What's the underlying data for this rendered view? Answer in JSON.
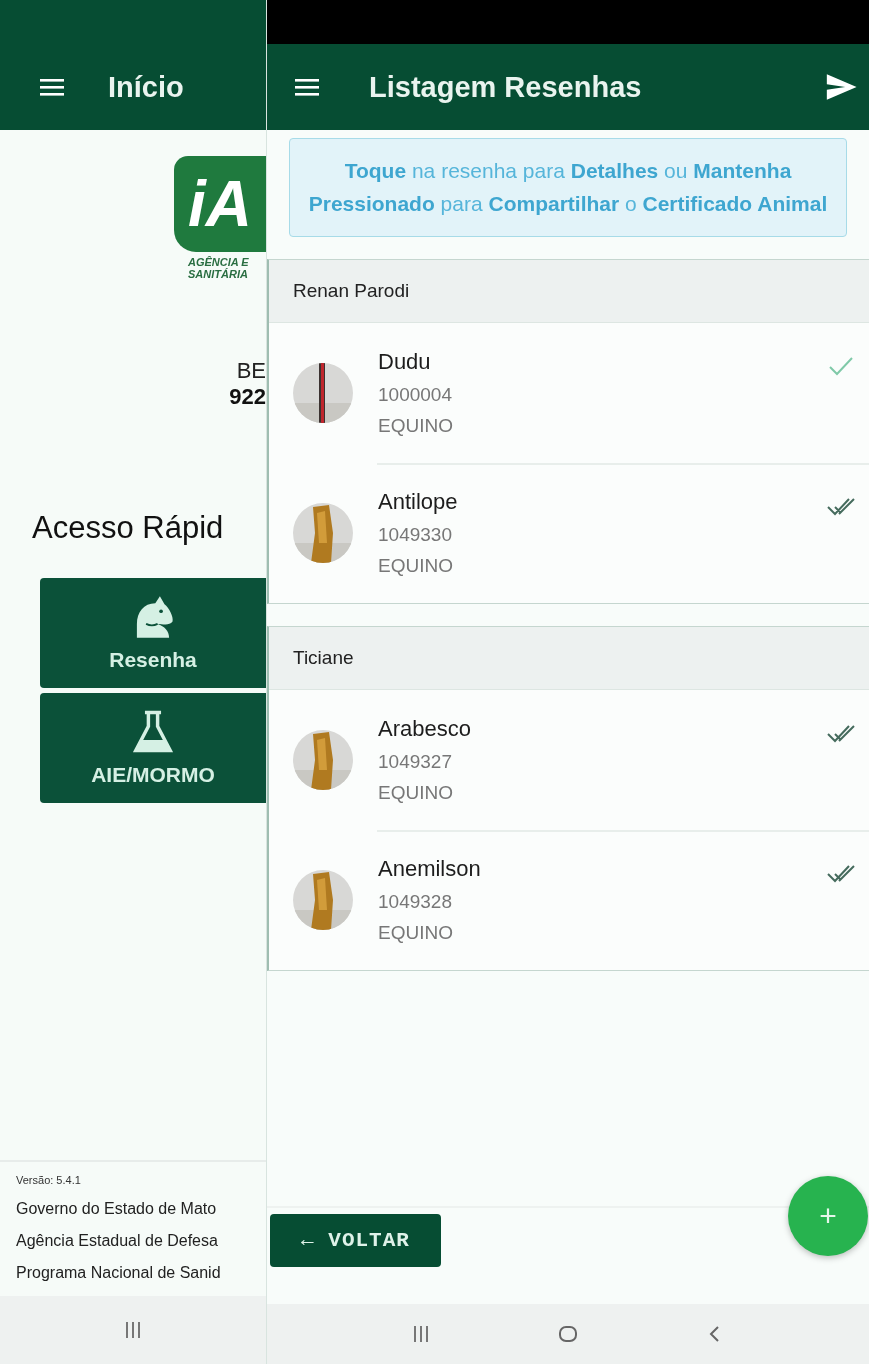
{
  "home": {
    "title": "Início",
    "logo_text": "iA",
    "logo_lines": [
      "AGÊNCIA E",
      "SANITÁRIA"
    ],
    "user_lines": [
      "BE",
      "922"
    ],
    "section_title": "Acesso Rápid",
    "shortcuts": [
      {
        "kind": "horse",
        "label": "Resenha"
      },
      {
        "kind": "flask",
        "label": "AIE/MORMO"
      }
    ],
    "version": "Versão: 5.4.1",
    "footer_lines": [
      "Governo do Estado de Mato",
      "Agência Estadual de Defesa",
      "Programa Nacional de Sanid"
    ]
  },
  "listing": {
    "title": "Listagem Resenhas",
    "hint": "**Toque** na resenha para **Detalhes** ou **Mantenha Pressionado** para **Compartilhar** o **Certificado Animal**",
    "groups": [
      {
        "owner": "Renan Parodi",
        "animals": [
          {
            "kind": "single-check",
            "name": "Dudu",
            "number": "1000004",
            "species": "EQUINO"
          },
          {
            "kind": "double-check",
            "name": "Antilope",
            "number": "1049330",
            "species": "EQUINO"
          }
        ]
      },
      {
        "owner": "Ticiane",
        "animals": [
          {
            "kind": "double-check",
            "name": "Arabesco",
            "number": "1049327",
            "species": "EQUINO"
          },
          {
            "kind": "double-check",
            "name": "Anemilson",
            "number": "1049328",
            "species": "EQUINO"
          }
        ]
      }
    ],
    "back_button": "← VOLTAR",
    "add_button": "+"
  }
}
